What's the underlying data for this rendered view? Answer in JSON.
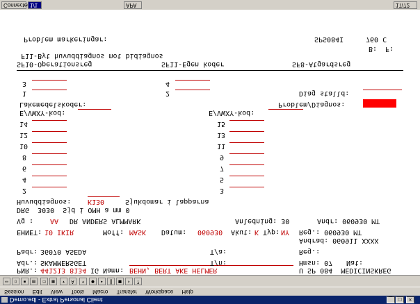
{
  "window": {
    "title": "Demo.edl - Extra! Personal Client",
    "controls": [
      "_",
      "□",
      "×"
    ]
  },
  "menu": [
    "Session",
    "Edit",
    "View",
    "Tools",
    "Macro",
    "Transfer",
    "Workspace",
    "Help"
  ],
  "status": {
    "left": "Connected",
    "right_top": "1/1",
    "page": "17/72",
    "mode": "APA"
  },
  "terminal": {
    "pnr_label": "PNR.:",
    "pnr_value": "441213 8134",
    "ig_label": "IG",
    "namn_label": "Namn:",
    "namn_value": "BEHN, BERT AKE HELMER",
    "clinic": "U SP 084  MEDICINSKREG",
    "adr_label": "Adr.:",
    "adr_value": "SKAMMERSGET",
    "tn_label": "T/n:",
    "hmsn_label": "Hmsn: 07",
    "nat_label": "Nat:",
    "padr_label": "Padr:",
    "padr_value": "36070 ASEDA",
    "ta_label": "T/a:",
    "reg_label": "Reg.:",
    "andrad_label": "Andrad: 060911 XXXX",
    "enhet_label": "EHNET:",
    "enhet_value": "10 IKIR",
    "moff_label": "Moff:",
    "moff_value": "MASK",
    "datum_label": "Datum:",
    "datum_value": "060930",
    "akut_label": "Akut:",
    "akut_value": "K",
    "typ_label": "Typ:",
    "typ_value": "NY",
    "reg2_label": "Reg.: 060930 MT",
    "vg_label": "Vg :",
    "vg_value": "AA",
    "doctor": "DR ANDERS ALMMARK",
    "anledning": "Anledning: 30",
    "andr_label": "Andr: 060930 MT",
    "drg": "DRG  3030  Sjd i OMH a mm 0",
    "huvuddiagnos_label": "Huvuddiagnos:",
    "huvuddiagnos_value": "K130",
    "huvuddiagnos_desc": "Sjukdomar i lapparna",
    "numbers_left": [
      "2",
      "4",
      "6",
      "8",
      "10",
      "12",
      "14"
    ],
    "numbers_right": [
      "3",
      "5",
      "7",
      "9",
      "11",
      "13",
      "15"
    ],
    "evwxy_left": "E/VWXY-kod:",
    "evwxy_right": "E/VWXY-kod:",
    "lakemedel": "Lakemedelskoder:",
    "problem_diag": "Problem/Diagnos:",
    "diag_stalld": "Diag stalld:",
    "op_1": "1",
    "op_2": "2",
    "op_3": "3",
    "op_4": "4",
    "sf10": "SF10-Operationsreg",
    "sf11": "SF11-Egen koder",
    "sf8": "SF8-Atgardsreg",
    "f11_hint": "F11-Byt huvuddiagnos mot bidiagnos",
    "problem_mark": "Problem markeringar:",
    "screen_id": "SPS084I",
    "screen_num": "760 C",
    "page_b": "B:",
    "page_f": "F:"
  },
  "colors": {
    "field": "#c00000",
    "title_bg": "#0a246a",
    "chrome": "#d4d0c8",
    "alert": "#ff0000"
  }
}
